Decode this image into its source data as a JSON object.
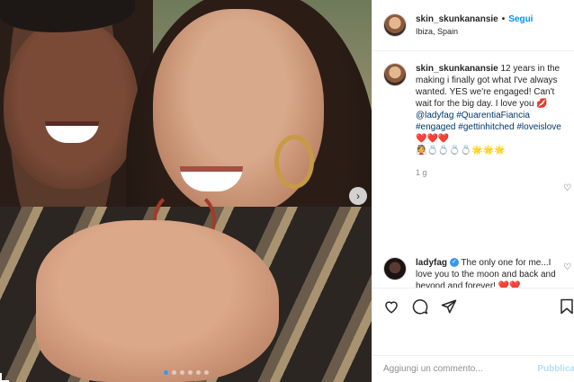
{
  "post": {
    "username": "skin_skunkanansie",
    "follow_label": "Segui",
    "follow_separator": "•",
    "location": "Ibiza, Spain"
  },
  "caption": {
    "username": "skin_skunkanansie",
    "text_before": "12 years in the making i finally got what I've always wanted. YES we're engaged! Can't wait for the big day. I love you",
    "kiss_emoji": "💋",
    "mention": "@ladyfag",
    "hashtags": [
      "#QuarentiaFiancia",
      "#engaged",
      "#gettinhitched",
      "#loveislove"
    ],
    "hearts": "❤️❤️❤️",
    "emoji_row": "👰💍💍💍💍🌟🌟🌟",
    "time": "1 g"
  },
  "comment": {
    "username": "ladyfag",
    "text": "The only one for me...I love you to the moon and back and beyond and forever!",
    "hearts": "❤️❤️"
  },
  "add_comment": {
    "placeholder": "Aggiungi un commento...",
    "publish_label": "Pubblica"
  },
  "colors": {
    "link": "#00376b",
    "follow": "#0095f6",
    "publish_disabled": "#b2dffc"
  }
}
